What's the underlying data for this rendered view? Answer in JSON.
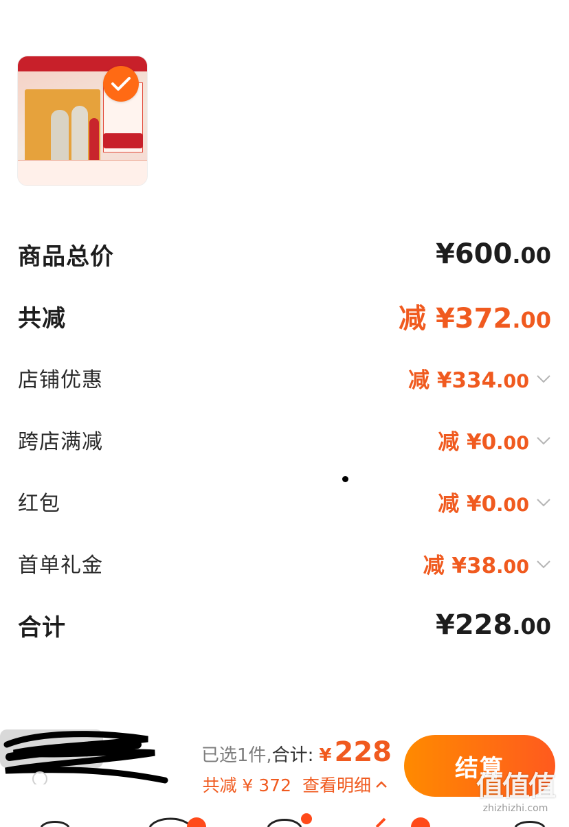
{
  "summary": {
    "goods_total": {
      "label": "商品总价",
      "int": "¥600",
      "dec": ".00"
    },
    "total_reduction": {
      "label": "共减",
      "int": "减 ¥372",
      "dec": ".00"
    },
    "store_discount": {
      "label": "店铺优惠",
      "int": "减 ¥334",
      "dec": ".00"
    },
    "cross_store": {
      "label": "跨店满减",
      "int": "减 ¥0",
      "dec": ".00"
    },
    "red_packet": {
      "label": "红包",
      "int": "减 ¥0",
      "dec": ".00"
    },
    "first_order_gift": {
      "label": "首单礼金",
      "int": "减 ¥38",
      "dec": ".00"
    },
    "grand_total": {
      "label": "合计",
      "int": "¥228",
      "dec": ".00"
    }
  },
  "footer": {
    "selected_text": "已选1件,",
    "total_label": "合计:",
    "currency": "¥",
    "total": "228",
    "saving_text": "共减 ¥ 372",
    "detail_text": "查看明细",
    "checkout_label": "结算"
  },
  "watermark": {
    "big": "值值值",
    "small": "zhizhizhi.com"
  },
  "colors": {
    "accent": "#f05a1f",
    "checkout_start": "#ff8a00",
    "checkout_end": "#ff5a1e"
  }
}
